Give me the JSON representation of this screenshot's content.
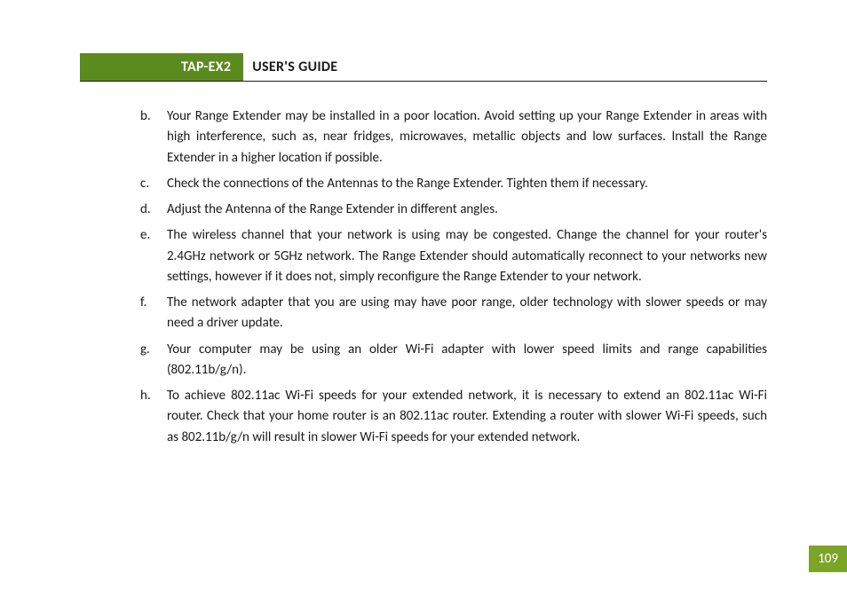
{
  "header": {
    "product": "TAP-EX2",
    "title": "USER'S GUIDE"
  },
  "list": [
    {
      "marker": "b.",
      "text": "Your Range Extender may be installed in a poor location. Avoid setting up your Range Extender in areas with high interference, such as, near fridges, microwaves, metallic objects and low surfaces. Install the Range Extender in a higher location if possible."
    },
    {
      "marker": "c.",
      "text": "Check the connections of the Antennas to the Range Extender. Tighten them if necessary."
    },
    {
      "marker": "d.",
      "text": "Adjust the Antenna of the Range Extender in different angles."
    },
    {
      "marker": "e.",
      "text": "The wireless channel that your network is using may be congested. Change the channel for your router's 2.4GHz network or 5GHz network. The Range Extender should automatically reconnect to your networks new settings, however if it does not, simply reconfigure the Range Extender to your network."
    },
    {
      "marker": "f.",
      "text": "The network adapter that you are using may have poor range, older technology with slower speeds or may need a driver update."
    },
    {
      "marker": "g.",
      "text": "Your computer may be using an older Wi-Fi adapter with lower speed limits and range capabilities (802.11b/g/n)."
    },
    {
      "marker": "h.",
      "text": "To achieve 802.11ac Wi-Fi speeds for your extended network, it is necessary to extend an 802.11ac Wi-Fi router.  Check that your home router is an 802.11ac router.  Extending a router with slower Wi-Fi speeds, such as 802.11b/g/n will result in slower Wi-Fi speeds for your extended network."
    }
  ],
  "page_number": "109"
}
